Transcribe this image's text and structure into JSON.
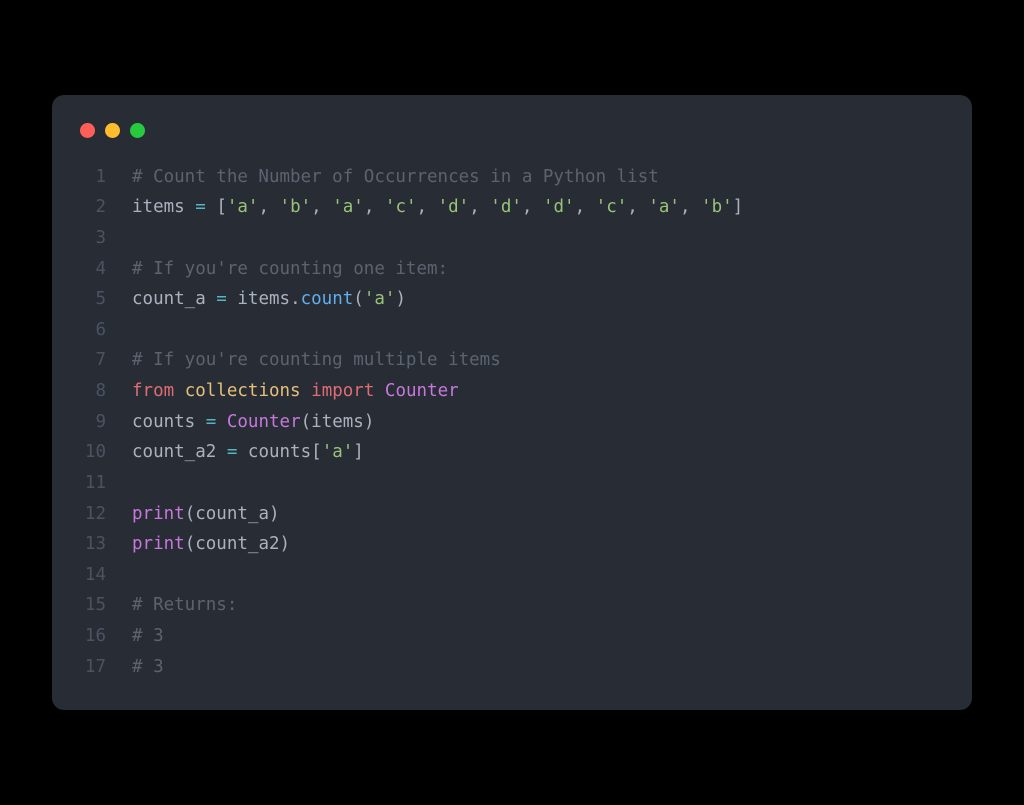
{
  "window": {
    "dots": [
      "red",
      "yellow",
      "green"
    ]
  },
  "code": {
    "lines": [
      {
        "num": "1",
        "tokens": [
          {
            "cls": "tk-comment",
            "text": "# Count the Number of Occurrences in a Python list"
          }
        ]
      },
      {
        "num": "2",
        "tokens": [
          {
            "cls": "tk-default",
            "text": "items "
          },
          {
            "cls": "tk-op",
            "text": "="
          },
          {
            "cls": "tk-default",
            "text": " "
          },
          {
            "cls": "tk-punc",
            "text": "["
          },
          {
            "cls": "tk-string",
            "text": "'a'"
          },
          {
            "cls": "tk-punc",
            "text": ", "
          },
          {
            "cls": "tk-string",
            "text": "'b'"
          },
          {
            "cls": "tk-punc",
            "text": ", "
          },
          {
            "cls": "tk-string",
            "text": "'a'"
          },
          {
            "cls": "tk-punc",
            "text": ", "
          },
          {
            "cls": "tk-string",
            "text": "'c'"
          },
          {
            "cls": "tk-punc",
            "text": ", "
          },
          {
            "cls": "tk-string",
            "text": "'d'"
          },
          {
            "cls": "tk-punc",
            "text": ", "
          },
          {
            "cls": "tk-string",
            "text": "'d'"
          },
          {
            "cls": "tk-punc",
            "text": ", "
          },
          {
            "cls": "tk-string",
            "text": "'d'"
          },
          {
            "cls": "tk-punc",
            "text": ", "
          },
          {
            "cls": "tk-string",
            "text": "'c'"
          },
          {
            "cls": "tk-punc",
            "text": ", "
          },
          {
            "cls": "tk-string",
            "text": "'a'"
          },
          {
            "cls": "tk-punc",
            "text": ", "
          },
          {
            "cls": "tk-string",
            "text": "'b'"
          },
          {
            "cls": "tk-punc",
            "text": "]"
          }
        ]
      },
      {
        "num": "3",
        "tokens": []
      },
      {
        "num": "4",
        "tokens": [
          {
            "cls": "tk-comment",
            "text": "# If you're counting one item:"
          }
        ]
      },
      {
        "num": "5",
        "tokens": [
          {
            "cls": "tk-default",
            "text": "count_a "
          },
          {
            "cls": "tk-op",
            "text": "="
          },
          {
            "cls": "tk-default",
            "text": " items"
          },
          {
            "cls": "tk-punc",
            "text": "."
          },
          {
            "cls": "tk-func",
            "text": "count"
          },
          {
            "cls": "tk-punc",
            "text": "("
          },
          {
            "cls": "tk-string",
            "text": "'a'"
          },
          {
            "cls": "tk-punc",
            "text": ")"
          }
        ]
      },
      {
        "num": "6",
        "tokens": []
      },
      {
        "num": "7",
        "tokens": [
          {
            "cls": "tk-comment",
            "text": "# If you're counting multiple items"
          }
        ]
      },
      {
        "num": "8",
        "tokens": [
          {
            "cls": "tk-red",
            "text": "from"
          },
          {
            "cls": "tk-default",
            "text": " "
          },
          {
            "cls": "tk-module",
            "text": "collections"
          },
          {
            "cls": "tk-default",
            "text": " "
          },
          {
            "cls": "tk-red",
            "text": "import"
          },
          {
            "cls": "tk-default",
            "text": " "
          },
          {
            "cls": "tk-builtin",
            "text": "Counter"
          }
        ]
      },
      {
        "num": "9",
        "tokens": [
          {
            "cls": "tk-default",
            "text": "counts "
          },
          {
            "cls": "tk-op",
            "text": "="
          },
          {
            "cls": "tk-default",
            "text": " "
          },
          {
            "cls": "tk-builtin",
            "text": "Counter"
          },
          {
            "cls": "tk-punc",
            "text": "(items)"
          }
        ]
      },
      {
        "num": "10",
        "tokens": [
          {
            "cls": "tk-default",
            "text": "count_a2 "
          },
          {
            "cls": "tk-op",
            "text": "="
          },
          {
            "cls": "tk-default",
            "text": " counts"
          },
          {
            "cls": "tk-punc",
            "text": "["
          },
          {
            "cls": "tk-string",
            "text": "'a'"
          },
          {
            "cls": "tk-punc",
            "text": "]"
          }
        ]
      },
      {
        "num": "11",
        "tokens": []
      },
      {
        "num": "12",
        "tokens": [
          {
            "cls": "tk-builtin",
            "text": "print"
          },
          {
            "cls": "tk-punc",
            "text": "(count_a)"
          }
        ]
      },
      {
        "num": "13",
        "tokens": [
          {
            "cls": "tk-builtin",
            "text": "print"
          },
          {
            "cls": "tk-punc",
            "text": "(count_a2)"
          }
        ]
      },
      {
        "num": "14",
        "tokens": []
      },
      {
        "num": "15",
        "tokens": [
          {
            "cls": "tk-comment",
            "text": "# Returns:"
          }
        ]
      },
      {
        "num": "16",
        "tokens": [
          {
            "cls": "tk-comment",
            "text": "# 3"
          }
        ]
      },
      {
        "num": "17",
        "tokens": [
          {
            "cls": "tk-comment",
            "text": "# 3"
          }
        ]
      }
    ]
  }
}
